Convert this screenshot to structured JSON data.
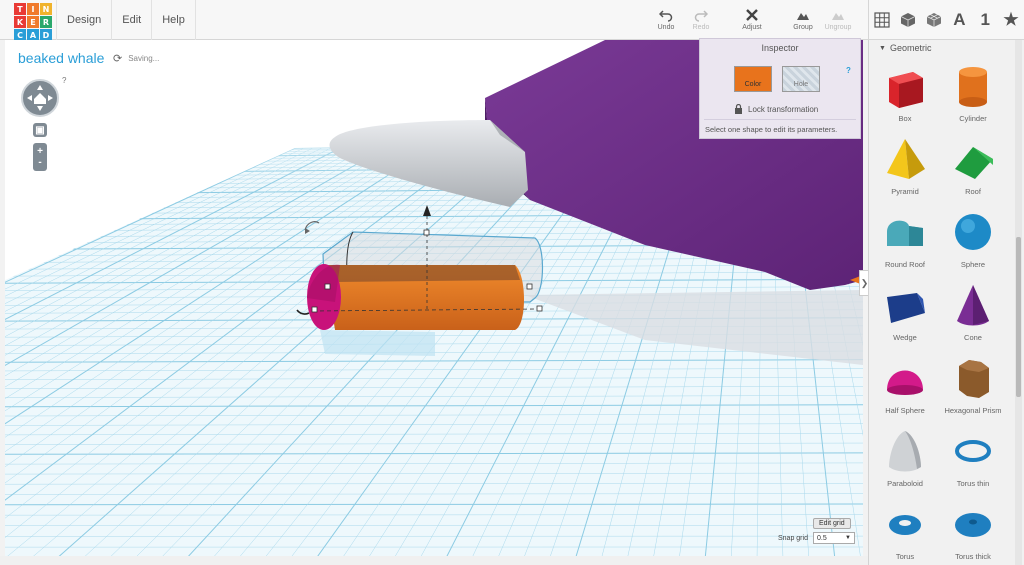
{
  "logo_letters": [
    "T",
    "I",
    "N",
    "K",
    "E",
    "R",
    "C",
    "A",
    "D"
  ],
  "logo_colors": [
    "#e93a35",
    "#f07a2c",
    "#f0b32c",
    "#e93a35",
    "#f07a2c",
    "#2aa86b",
    "#2a9ed7",
    "#2a9ed7",
    "#2a9ed7"
  ],
  "menu": [
    "Design",
    "Edit",
    "Help"
  ],
  "toolbar": {
    "undo": "Undo",
    "redo": "Redo",
    "adjust": "Adjust",
    "group": "Group",
    "ungroup": "Ungroup"
  },
  "view_icons": [
    "grid-view-icon",
    "cube-view-icon",
    "blocks-view-icon",
    "A",
    "1",
    "★"
  ],
  "project": {
    "title": "beaked whale",
    "status": "Saving..."
  },
  "help_mark": "?",
  "inspector": {
    "title": "Inspector",
    "color_label": "Color",
    "hole_label": "Hole",
    "help": "?",
    "lock_label": "Lock transformation",
    "hint": "Select one shape to edit its parameters."
  },
  "grid": {
    "edit_label": "Edit grid",
    "snap_label": "Snap grid",
    "snap_value": "0.5"
  },
  "panel": {
    "section": "Geometric",
    "shapes": [
      {
        "name": "Box",
        "icon": "box-icon"
      },
      {
        "name": "Cylinder",
        "icon": "cylinder-icon"
      },
      {
        "name": "Pyramid",
        "icon": "pyramid-icon"
      },
      {
        "name": "Roof",
        "icon": "roof-icon"
      },
      {
        "name": "Round Roof",
        "icon": "round-roof-icon"
      },
      {
        "name": "Sphere",
        "icon": "sphere-icon"
      },
      {
        "name": "Wedge",
        "icon": "wedge-icon"
      },
      {
        "name": "Cone",
        "icon": "cone-icon"
      },
      {
        "name": "Half Sphere",
        "icon": "half-sphere-icon"
      },
      {
        "name": "Hexagonal Prism",
        "icon": "hexagonal-prism-icon"
      },
      {
        "name": "Paraboloid",
        "icon": "paraboloid-icon"
      },
      {
        "name": "Torus thin",
        "icon": "torus-thin-icon"
      },
      {
        "name": "Torus",
        "icon": "torus-icon"
      },
      {
        "name": "Torus thick",
        "icon": "torus-thick-icon"
      }
    ]
  },
  "colors": {
    "accent": "#2a9ed7",
    "whale_body": "#6b2d86",
    "beak": "#c9cccf",
    "selected_shape": "#e8731c",
    "hole_tip": "#c8127a",
    "grid_line": "#a9d9ec"
  }
}
